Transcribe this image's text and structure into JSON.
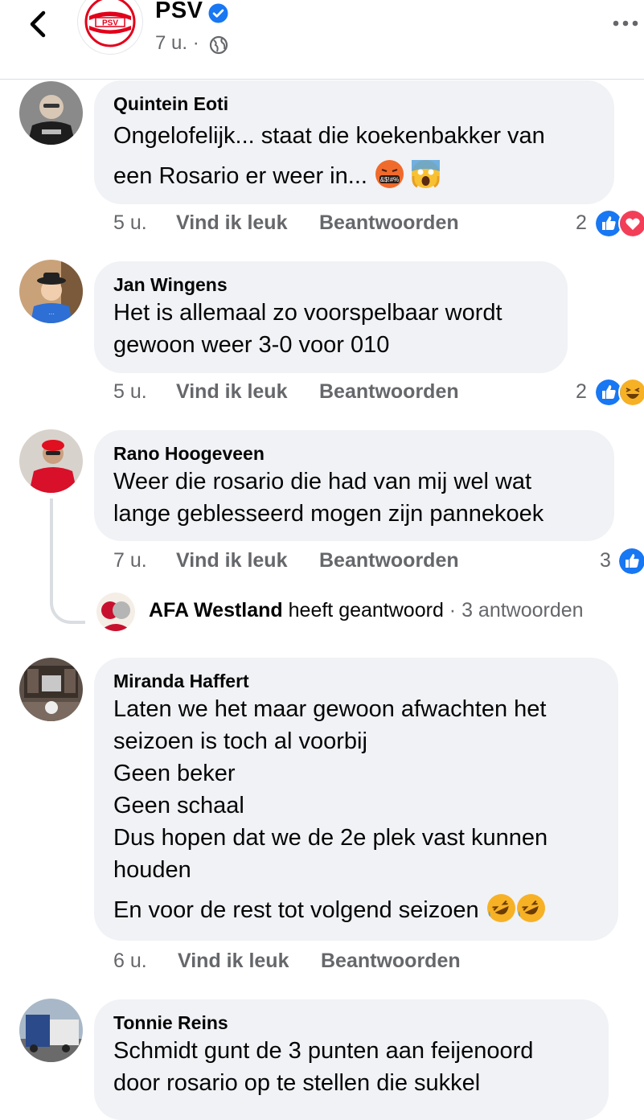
{
  "header": {
    "page_name": "PSV",
    "avatar_text": "PSV",
    "post_time": "7 u. ·"
  },
  "actions": {
    "like": "Vind ik leuk",
    "reply": "Beantwoorden"
  },
  "comments": [
    {
      "author": "Quintein Eoti",
      "lines": [
        "Ongelofelijk... staat die koekenbakker van",
        "een Rosario er weer in..."
      ],
      "emoji_grawlix": "&$!#%",
      "time": "5 u.",
      "reaction_count": "2"
    },
    {
      "author": "Jan Wingens",
      "lines": [
        "Het is allemaal zo voorspelbaar wordt",
        "gewoon weer 3-0 voor 010"
      ],
      "time": "5 u.",
      "reaction_count": "2"
    },
    {
      "author": "Rano Hoogeveen",
      "lines": [
        "Weer die rosario die had van mij wel wat",
        "lange geblesseerd mogen zijn pannekoek"
      ],
      "time": "7 u.",
      "reaction_count": "3",
      "reply_summary": {
        "author": "AFA Westland",
        "text": "heeft geantwoord",
        "count": "· 3 antwoorden"
      }
    },
    {
      "author": "Miranda Haffert",
      "lines": [
        "Laten we het maar gewoon afwachten het",
        "seizoen is toch al voorbij",
        "Geen beker",
        "Geen schaal",
        "Dus hopen dat we de 2e plek vast kunnen",
        "houden",
        "En voor de rest tot volgend seizoen"
      ],
      "time": "6 u."
    },
    {
      "author": "Tonnie Reins",
      "lines": [
        "Schmidt gunt de 3 punten aan feijenoord",
        "door rosario op te stellen die sukkel"
      ]
    }
  ],
  "colors": {
    "like_blue": "#1877f2",
    "love_red": "#f33e58",
    "haha_yellow": "#f7b125",
    "bubble_bg": "#f0f2f5",
    "muted": "#65676b",
    "psv_red": "#e2001a"
  }
}
